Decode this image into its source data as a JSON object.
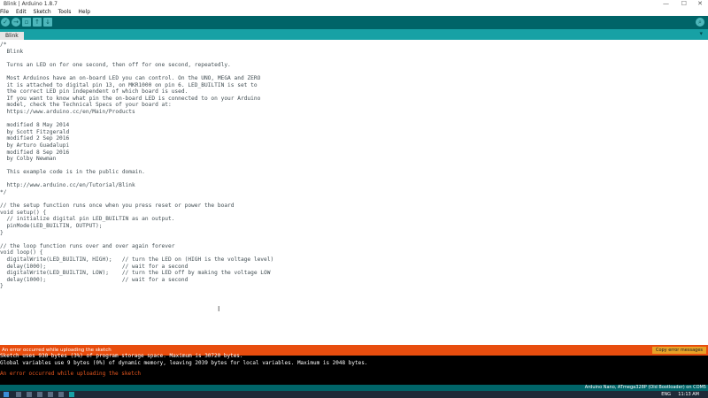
{
  "window": {
    "title": "Blink | Arduino 1.8.7",
    "minimize": "—",
    "maximize": "☐",
    "close": "✕"
  },
  "menu": [
    "File",
    "Edit",
    "Sketch",
    "Tools",
    "Help"
  ],
  "toolbar": {
    "verify_icon": "check-icon",
    "upload_icon": "arrow-right-icon",
    "new_icon": "new-file-icon",
    "open_icon": "arrow-up-icon",
    "save_icon": "arrow-down-icon",
    "serial_monitor_icon": "magnifier-icon"
  },
  "tab": {
    "name": "Blink",
    "menu_arrow": "▾"
  },
  "code": [
    "/*",
    "  Blink",
    "",
    "  Turns an LED on for one second, then off for one second, repeatedly.",
    "",
    "  Most Arduinos have an on-board LED you can control. On the UNO, MEGA and ZERO",
    "  it is attached to digital pin 13, on MKR1000 on pin 6. LED_BUILTIN is set to",
    "  the correct LED pin independent of which board is used.",
    "  If you want to know what pin the on-board LED is connected to on your Arduino",
    "  model, check the Technical Specs of your board at:",
    "  https://www.arduino.cc/en/Main/Products",
    "",
    "  modified 8 May 2014",
    "  by Scott Fitzgerald",
    "  modified 2 Sep 2016",
    "  by Arturo Guadalupi",
    "  modified 8 Sep 2016",
    "  by Colby Newman",
    "",
    "  This example code is in the public domain.",
    "",
    "  http://www.arduino.cc/en/Tutorial/Blink",
    "*/",
    "",
    "// the setup function runs once when you press reset or power the board",
    "void setup() {",
    "  // initialize digital pin LED_BUILTIN as an output.",
    "  pinMode(LED_BUILTIN, OUTPUT);",
    "}",
    "",
    "// the loop function runs over and over again forever",
    "void loop() {",
    "  digitalWrite(LED_BUILTIN, HIGH);   // turn the LED on (HIGH is the voltage level)",
    "  delay(1000);                       // wait for a second",
    "  digitalWrite(LED_BUILTIN, LOW);    // turn the LED off by making the voltage LOW",
    "  delay(1000);                       // wait for a second",
    "}"
  ],
  "status": {
    "message": "An error occurred while uploading the sketch",
    "copy_button": "Copy error messages"
  },
  "console": [
    "Sketch uses 930 bytes (3%) of program storage space. Maximum is 30720 bytes.",
    "Global variables use 9 bytes (0%) of dynamic memory, leaving 2039 bytes for local variables. Maximum is 2048 bytes.",
    "",
    "An error occurred while uploading the sketch"
  ],
  "board_info": "Arduino Nano, ATmega328P (Old Bootloader) on COM5",
  "taskbar": {
    "clock": "11:13 AM",
    "lang": "ENG"
  },
  "colors": {
    "toolbar": "#006468",
    "tabbar": "#17a1a5",
    "status_error": "#e84d0e",
    "console_bg": "#000000",
    "console_error": "#e8571f"
  }
}
